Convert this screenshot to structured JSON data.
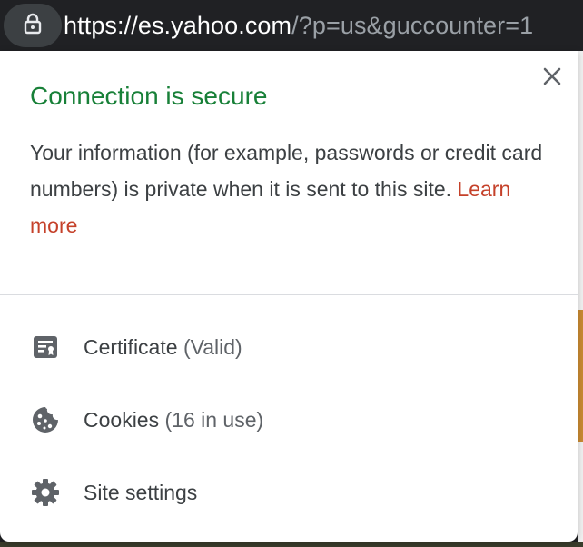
{
  "omnibox": {
    "url_host": "https://es.yahoo.com",
    "url_rest": "/?p=us&guccounter=1"
  },
  "popup": {
    "title": "Connection is secure",
    "description": "Your information (for example, passwords or credit card numbers) is private when it is sent to this site.",
    "learn_more": "Learn more",
    "items": [
      {
        "label": "Certificate",
        "sub": "(Valid)",
        "icon": "certificate-icon"
      },
      {
        "label": "Cookies",
        "sub": "(16 in use)",
        "icon": "cookie-icon"
      },
      {
        "label": "Site settings",
        "sub": "",
        "icon": "gear-icon"
      }
    ]
  },
  "colors": {
    "secure_title": "#188038",
    "link": "#c5412a",
    "text": "#3c4043",
    "icon": "#5f6368"
  }
}
